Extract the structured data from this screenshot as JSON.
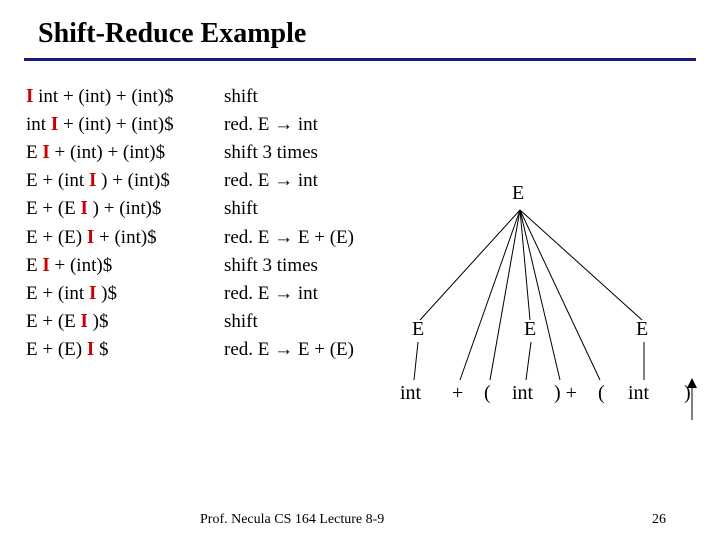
{
  "title": "Shift-Reduce Example",
  "rows": [
    {
      "left_pre": "",
      "left_post": " int + (int) + (int)$",
      "right": "shift"
    },
    {
      "left_pre": "int ",
      "left_post": " + (int) + (int)$",
      "right": "red. E → int"
    },
    {
      "left_pre": "E ",
      "left_post": " + (int) + (int)$",
      "right": "shift 3 times"
    },
    {
      "left_pre": "E + (int ",
      "left_post": " ) + (int)$",
      "right": "red. E → int"
    },
    {
      "left_pre": "E + (E ",
      "left_post": " ) + (int)$",
      "right": "shift"
    },
    {
      "left_pre": "E + (E) ",
      "left_post": " + (int)$",
      "right": "red. E → E + (E)"
    },
    {
      "left_pre": "E ",
      "left_post": " + (int)$",
      "right": "shift 3 times"
    },
    {
      "left_pre": "E + (int ",
      "left_post": " )$",
      "right": "red. E → int"
    },
    {
      "left_pre": "E + (E ",
      "left_post": " )$",
      "right": "shift"
    },
    {
      "left_pre": "E + (E) ",
      "left_post": " $",
      "right": "red. E → E + (E)"
    }
  ],
  "tree": {
    "root": "E",
    "mid": [
      "E",
      "E",
      "E"
    ],
    "leaves": [
      "int",
      "+",
      "(",
      "int",
      ") +",
      "(",
      "int",
      ")"
    ]
  },
  "footer_left": "Prof. Necula  CS 164  Lecture 8-9",
  "footer_right": "26",
  "bar_glyph": "I"
}
